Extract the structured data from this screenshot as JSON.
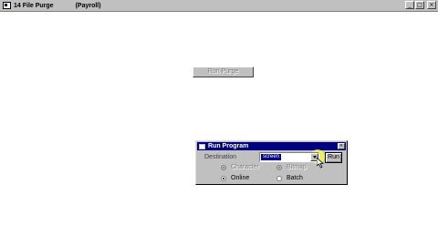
{
  "window": {
    "title": "14 File Purge",
    "subtitle": "(Payroll)",
    "controls": {
      "minimize": "_",
      "maximize": "□",
      "close": "×"
    }
  },
  "main": {
    "run_purge_label": "Run Purge"
  },
  "dialog": {
    "title": "Run Program",
    "close": "×",
    "destination_label": "Destination",
    "destination_value": "screen",
    "run_label": "Run",
    "options": {
      "character": {
        "label": "Character",
        "checked": true,
        "enabled": false
      },
      "bitmap": {
        "label": "Bitmap",
        "checked": true,
        "enabled": false
      },
      "online": {
        "label": "Online",
        "checked": true,
        "enabled": true
      },
      "batch": {
        "label": "Batch",
        "checked": false,
        "enabled": true
      }
    }
  },
  "colors": {
    "dialog_titlebar": "#000080",
    "face": "#c0c0c0",
    "highlight": "#ffff3c"
  }
}
